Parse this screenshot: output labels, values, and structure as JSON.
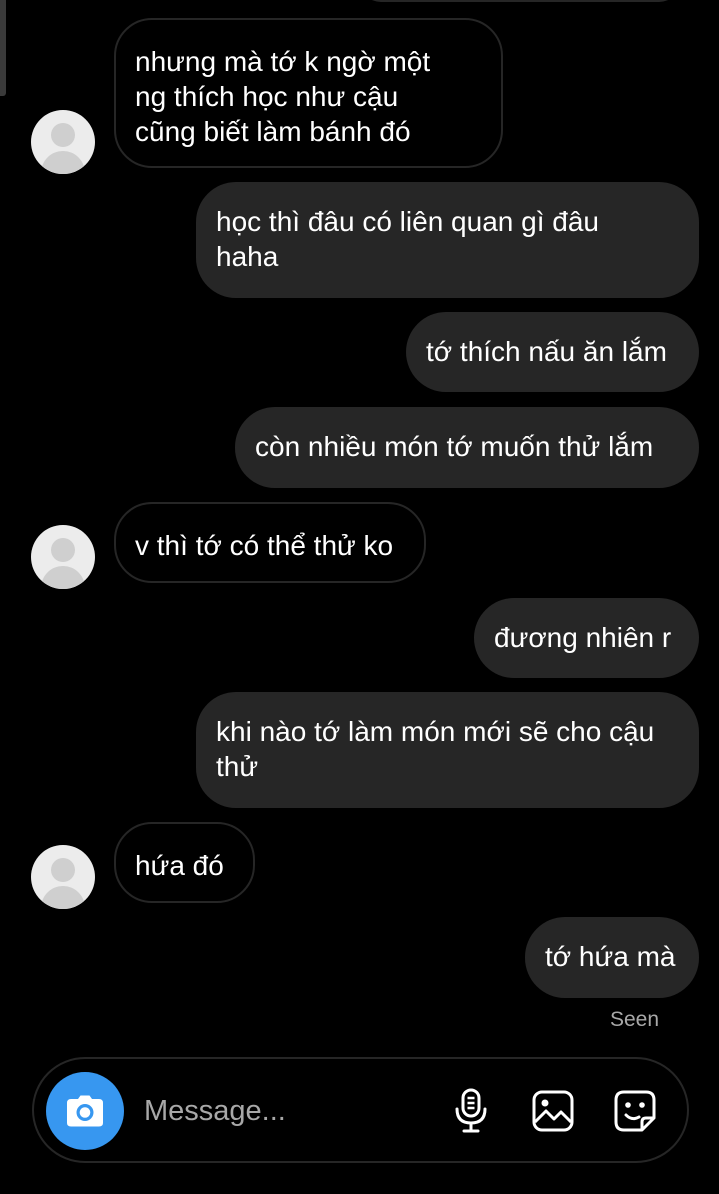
{
  "messages": [
    {
      "side": "incoming",
      "text": "nhưng mà tớ k ngờ một\nng thích học như cậu\ncũng biết làm bánh đó"
    },
    {
      "side": "outgoing",
      "text": "học thì đâu có liên quan gì đâu\nhaha"
    },
    {
      "side": "outgoing",
      "text": "tớ thích nấu ăn lắm"
    },
    {
      "side": "outgoing",
      "text": "còn nhiều món tớ muốn thử lắm"
    },
    {
      "side": "incoming",
      "text": "v thì tớ có thể thử ko"
    },
    {
      "side": "outgoing",
      "text": "đương nhiên r"
    },
    {
      "side": "outgoing",
      "text": "khi nào tớ làm món mới sẽ cho cậu\nthử"
    },
    {
      "side": "incoming",
      "text": "hứa đó"
    },
    {
      "side": "outgoing",
      "text": "tớ hứa mà"
    }
  ],
  "status": {
    "seen": "Seen"
  },
  "composer": {
    "placeholder": "Message...",
    "icons": {
      "camera": "camera-icon",
      "voice": "microphone-icon",
      "gallery": "image-icon",
      "sticker": "sticker-icon"
    }
  },
  "colors": {
    "background": "#000000",
    "outgoing_bubble": "#262626",
    "incoming_border": "#262626",
    "accent": "#3797f0",
    "muted_text": "#a8a8a8",
    "avatar": "#ececec"
  }
}
